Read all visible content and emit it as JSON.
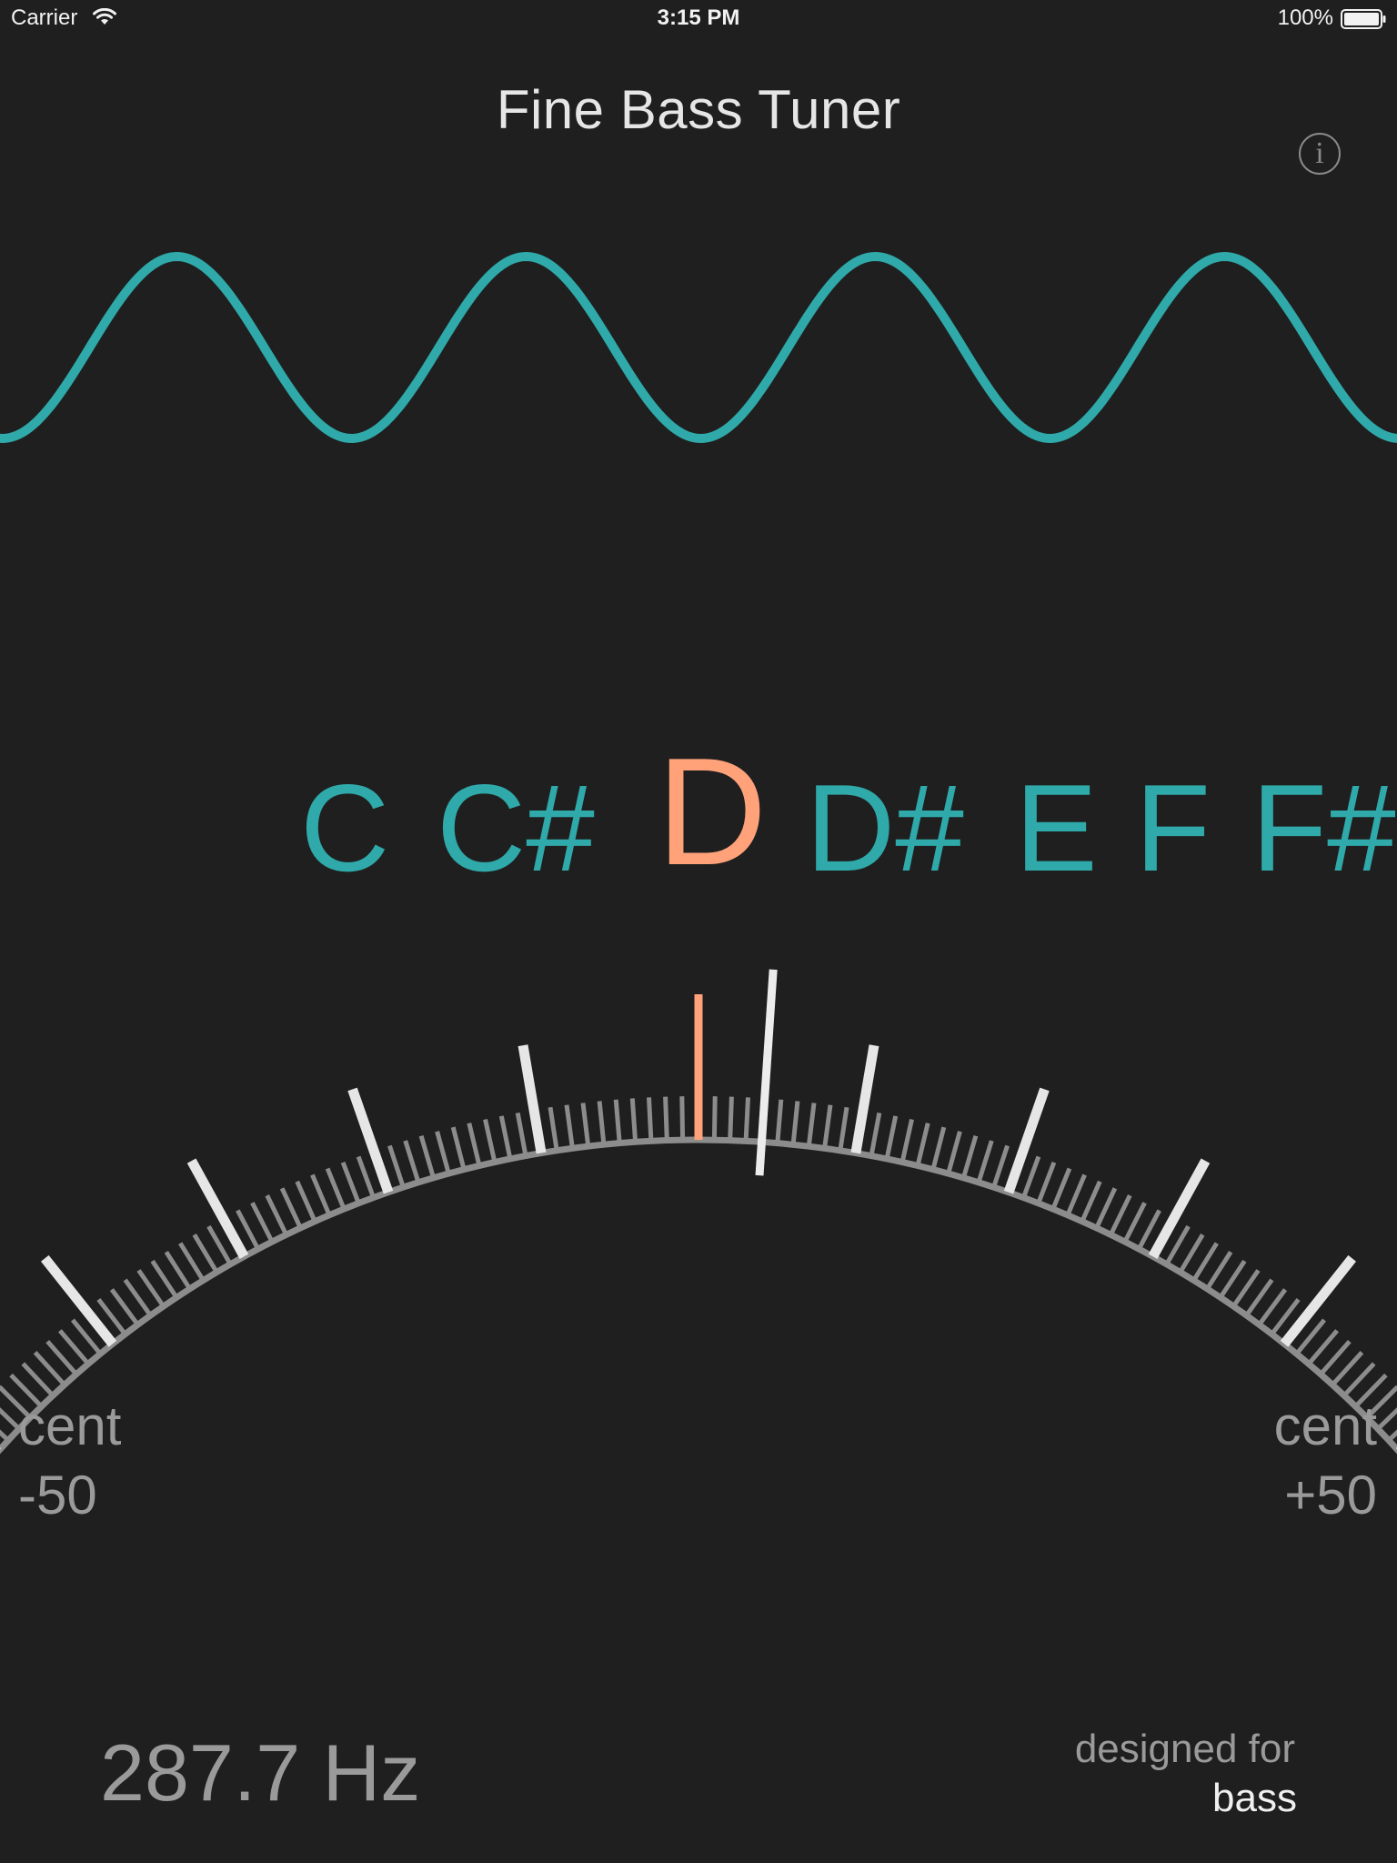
{
  "status_bar": {
    "carrier": "Carrier",
    "time": "3:15 PM",
    "battery": "100%"
  },
  "app": {
    "title": "Fine Bass Tuner",
    "info_icon": "info-circle-icon",
    "info_glyph": "i"
  },
  "notes": [
    {
      "label": "C",
      "active": false
    },
    {
      "label": "C#",
      "active": false
    },
    {
      "label": "D",
      "active": true
    },
    {
      "label": "D#",
      "active": false
    },
    {
      "label": "E",
      "active": false
    },
    {
      "label": "F",
      "active": false
    },
    {
      "label": "F#",
      "active": false
    }
  ],
  "meter": {
    "min_cents": -50,
    "max_cents": 50,
    "needle_cents": 4,
    "left_label": {
      "unit": "cent",
      "value": "-50"
    },
    "right_label": {
      "unit": "cent",
      "value": "+50"
    }
  },
  "readout": {
    "frequency": "287.7 Hz",
    "designed_for_label": "designed for",
    "instrument": "bass"
  },
  "colors": {
    "background": "#1f1f1f",
    "accent_teal": "#2fa9a9",
    "accent_orange": "#ffa27a",
    "tick_major": "#e6e6e6",
    "tick_minor": "#8c8c8c",
    "label_gray": "#9a9a9a"
  }
}
